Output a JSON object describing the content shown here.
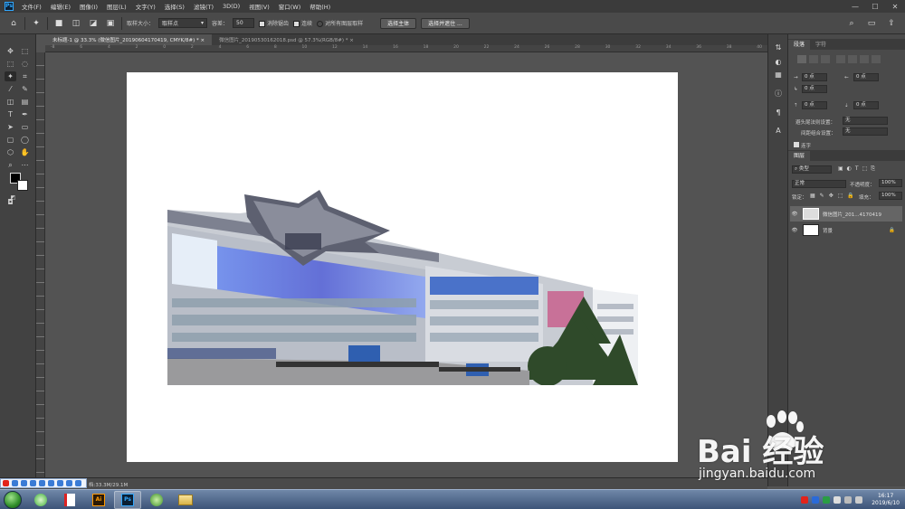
{
  "app": {
    "logo": "Ps"
  },
  "menu": [
    "文件(F)",
    "编辑(E)",
    "图像(I)",
    "图层(L)",
    "文字(Y)",
    "选择(S)",
    "滤镜(T)",
    "3D(D)",
    "视图(V)",
    "窗口(W)",
    "帮助(H)"
  ],
  "window_controls": {
    "minimize": "—",
    "maximize": "☐",
    "close": "✕"
  },
  "options": {
    "sample_size_label": "取样大小：",
    "sample_size_value": "取样点",
    "tolerance_label": "容差：",
    "tolerance_value": "50",
    "antialias_label": "消除锯齿",
    "contiguous_label": "连续",
    "sample_all_label": "对所有图层取样",
    "select_subject_label": "选择主体",
    "select_mask_label": "选择并遮住 ..."
  },
  "tabs": [
    {
      "label": "未标题-1 @ 33.3% (微信图片_20190604170419, CMYK/8#) *  ×",
      "active": true
    },
    {
      "label": "微信图片_20190530162018.psd @ 57.3%(RGB/8#) *  ×",
      "active": false
    }
  ],
  "ruler_ticks": [
    "-8",
    "6",
    "4",
    "2",
    "0",
    "2",
    "4",
    "6",
    "8",
    "10",
    "12",
    "14",
    "16",
    "18",
    "20",
    "22",
    "24",
    "26",
    "28",
    "30",
    "32",
    "34",
    "36",
    "38",
    "40"
  ],
  "paragraph_panel": {
    "tabs": [
      "段落",
      "字符"
    ],
    "left_indent": "0 点",
    "right_indent": "0 点",
    "first_line": "0 点",
    "space_before": "0 点",
    "space_after": "0 点",
    "hyphen_label": "避头尾法则设置：",
    "hyphen_value": "无",
    "spacing_label": "间距组合设置：",
    "spacing_value": "无",
    "hyphenate_label": "连字"
  },
  "layers_panel": {
    "tab": "图层",
    "filter_label": "类型",
    "blend_mode": "正常",
    "opacity_label": "不透明度：",
    "opacity_value": "100%",
    "lock_label": "锁定：",
    "fill_label": "填充：",
    "fill_value": "100%",
    "layers": [
      {
        "name": "微信图片_201...4170419",
        "selected": true
      },
      {
        "name": "背景",
        "selected": false
      }
    ]
  },
  "status": {
    "doc_size": "档:33.3M/29.1M"
  },
  "taskbar": {
    "time": "16:17",
    "date": "2019/6/10"
  },
  "watermark": {
    "brand": "Bai 经验",
    "url": "jingyan.baidu.com"
  },
  "colors": {
    "foreground": "#000000",
    "background": "#ffffff",
    "accent": "#31a8ff"
  }
}
